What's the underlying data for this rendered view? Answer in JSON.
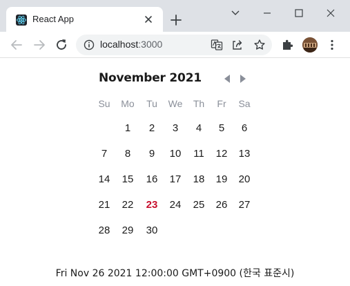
{
  "browser": {
    "tab_title": "React App",
    "url_host": "localhost",
    "url_port": ":3000"
  },
  "calendar": {
    "month_title": "November 2021",
    "weekdays": [
      "Su",
      "Mo",
      "Tu",
      "We",
      "Th",
      "Fr",
      "Sa"
    ],
    "first_weekday_index": 1,
    "days": [
      "1",
      "2",
      "3",
      "4",
      "5",
      "6",
      "7",
      "8",
      "9",
      "10",
      "11",
      "12",
      "13",
      "14",
      "15",
      "16",
      "17",
      "18",
      "19",
      "20",
      "21",
      "22",
      "23",
      "24",
      "25",
      "26",
      "27",
      "28",
      "29",
      "30"
    ],
    "today": "23",
    "today_color": "#c8102e"
  },
  "selected_date_string": "Fri Nov 26 2021 12:00:00 GMT+0900 (한국 표준시)"
}
